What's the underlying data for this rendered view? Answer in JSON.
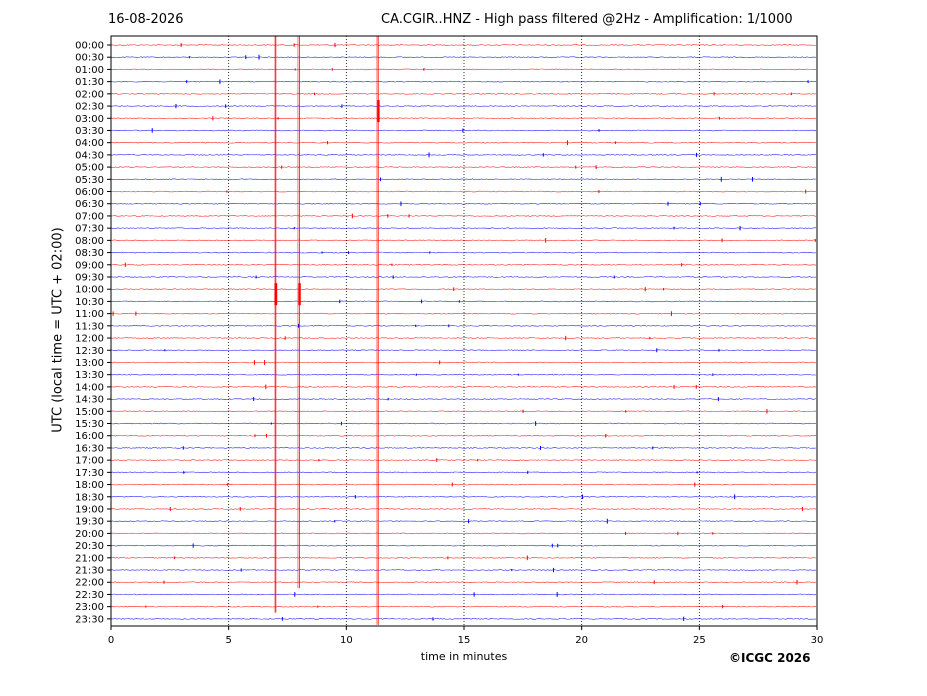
{
  "header": {
    "date": "16-08-2026",
    "title": "CA.CGIR..HNZ - High pass filtered @2Hz - Amplification: 1/1000"
  },
  "footer": {
    "copyright": "©ICGC 2026"
  },
  "colors": {
    "red_trace": "#ff0000",
    "blue_trace": "#0000ff",
    "grid": "#000000"
  },
  "chart_data": {
    "type": "line",
    "title": "CA.CGIR..HNZ - High pass filtered @2Hz - Amplification: 1/1000",
    "xlabel": "time in minutes",
    "ylabel": "UTC (local time = UTC + 02:00)",
    "xlim": [
      0,
      30
    ],
    "x_ticks": [
      "0",
      "5",
      "10",
      "15",
      "20",
      "25",
      "30"
    ],
    "y_ticks": [
      "00:00",
      "00:30",
      "01:00",
      "01:30",
      "02:00",
      "02:30",
      "03:00",
      "03:30",
      "04:00",
      "04:30",
      "05:00",
      "05:30",
      "06:00",
      "06:30",
      "07:00",
      "07:30",
      "08:00",
      "08:30",
      "09:00",
      "09:30",
      "10:00",
      "10:30",
      "11:00",
      "11:30",
      "12:00",
      "12:30",
      "13:00",
      "13:30",
      "14:00",
      "14:30",
      "15:00",
      "15:30",
      "16:00",
      "16:30",
      "17:00",
      "17:30",
      "18:00",
      "18:30",
      "19:00",
      "19:30",
      "20:00",
      "20:30",
      "21:00",
      "21:30",
      "22:00",
      "22:30",
      "23:00",
      "23:30"
    ],
    "vertical_gridlines_minutes": [
      5,
      10,
      15,
      20,
      25
    ],
    "grid_style": "dotted",
    "trace_color_pattern": [
      "red",
      "blue"
    ],
    "events": [
      {
        "minute": 7.0,
        "from_row": "00:00",
        "to_row": "23:00",
        "peak_row": "10:00",
        "color": "red"
      },
      {
        "minute": 8.0,
        "from_row": "00:00",
        "to_row": "22:00",
        "peak_row": "10:00",
        "color": "red"
      },
      {
        "minute": 11.35,
        "from_row": "00:00",
        "to_row": "23:30",
        "peak_row": "02:30",
        "color": "red"
      }
    ]
  }
}
